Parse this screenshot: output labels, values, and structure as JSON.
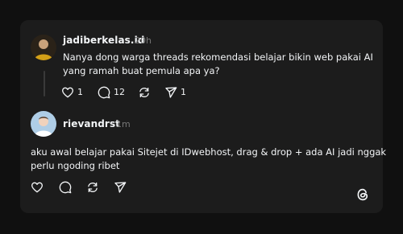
{
  "post": {
    "username": "jadiberkelas.id",
    "time": "20h",
    "text_line1": "Nanya dong warga threads rekomendasi belajar bikin web pakai AI",
    "text_line2": "yang ramah buat pemula apa ya?",
    "likes": "1",
    "replies": "12",
    "shares": "1"
  },
  "reply": {
    "username": "rievandrst",
    "time": "1m",
    "text_line1": "aku awal belajar pakai Sitejet di IDwebhost, drag & drop + ada AI jadi nggak",
    "text_line2": "perlu ngoding ribet"
  },
  "icons": [
    "heart-icon",
    "comment-icon",
    "repost-icon",
    "share-icon",
    "threads-logo-icon"
  ],
  "colors": {
    "background": "#101010",
    "card": "#1c1c1c",
    "text": "#f3f5f7",
    "muted": "#777777"
  }
}
